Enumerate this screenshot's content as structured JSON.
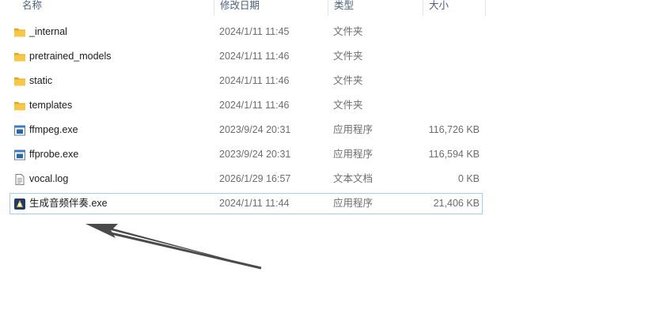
{
  "columns": {
    "name": "名称",
    "date": "修改日期",
    "type": "类型",
    "size": "大小"
  },
  "files": [
    {
      "name": "_internal",
      "date": "2024/1/11 11:45",
      "type": "文件夹",
      "size": "",
      "icon": "folder-icon"
    },
    {
      "name": "pretrained_models",
      "date": "2024/1/11 11:46",
      "type": "文件夹",
      "size": "",
      "icon": "folder-icon"
    },
    {
      "name": "static",
      "date": "2024/1/11 11:46",
      "type": "文件夹",
      "size": "",
      "icon": "folder-icon"
    },
    {
      "name": "templates",
      "date": "2024/1/11 11:46",
      "type": "文件夹",
      "size": "",
      "icon": "folder-icon"
    },
    {
      "name": "ffmpeg.exe",
      "date": "2023/9/24 20:31",
      "type": "应用程序",
      "size": "116,726 KB",
      "icon": "application-icon"
    },
    {
      "name": "ffprobe.exe",
      "date": "2023/9/24 20:31",
      "type": "应用程序",
      "size": "116,594 KB",
      "icon": "application-icon"
    },
    {
      "name": "vocal.log",
      "date": "2026/1/29 16:57",
      "type": "文本文档",
      "size": "0 KB",
      "icon": "text-document-icon"
    },
    {
      "name": "生成音频伴奏.exe",
      "date": "2024/1/11 11:44",
      "type": "应用程序",
      "size": "21,406 KB",
      "icon": "custom-app-icon",
      "selected": true
    }
  ],
  "colors": {
    "folder": "#f8c844",
    "folder_dark": "#e6a817",
    "selection_border": "#99d1ff",
    "arrow": "#4a4a4a"
  }
}
